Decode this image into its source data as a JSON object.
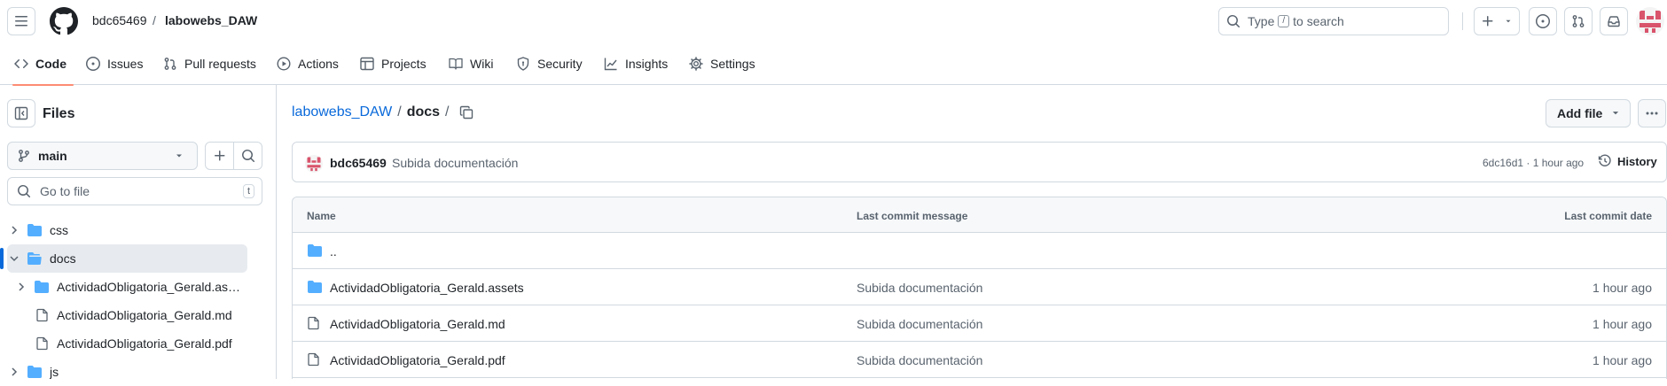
{
  "header": {
    "owner": "bdc65469",
    "separator": "/",
    "repo": "labowebs_DAW",
    "search_prefix": "Type",
    "search_key": "/",
    "search_suffix": "to search"
  },
  "repo_nav": [
    {
      "label": "Code",
      "icon": "code-icon",
      "active": true
    },
    {
      "label": "Issues",
      "icon": "issue-opened-icon"
    },
    {
      "label": "Pull requests",
      "icon": "git-pull-request-icon"
    },
    {
      "label": "Actions",
      "icon": "play-icon"
    },
    {
      "label": "Projects",
      "icon": "table-icon"
    },
    {
      "label": "Wiki",
      "icon": "book-icon"
    },
    {
      "label": "Security",
      "icon": "shield-icon"
    },
    {
      "label": "Insights",
      "icon": "graph-icon"
    },
    {
      "label": "Settings",
      "icon": "gear-icon"
    }
  ],
  "sidebar": {
    "title": "Files",
    "branch": "main",
    "goto_placeholder": "Go to file",
    "goto_key": "t",
    "tree": [
      {
        "label": "css",
        "type": "folder",
        "expanded": false
      },
      {
        "label": "docs",
        "type": "folder",
        "expanded": true,
        "selected": true
      },
      {
        "label": "ActividadObligatoria_Gerald.assets",
        "type": "folder",
        "expanded": false
      },
      {
        "label": "ActividadObligatoria_Gerald.md",
        "type": "file"
      },
      {
        "label": "ActividadObligatoria_Gerald.pdf",
        "type": "file"
      },
      {
        "label": "js",
        "type": "folder",
        "expanded": false
      }
    ]
  },
  "main": {
    "path_repo": "labowebs_DAW",
    "path_sep1": "/",
    "path_current": "docs",
    "path_sep2": "/",
    "add_file_label": "Add file",
    "commit": {
      "author": "bdc65469",
      "message": "Subida documentación",
      "hash_time": "6dc16d1 · 1 hour ago",
      "history_label": "History"
    },
    "table": {
      "headers": {
        "name": "Name",
        "message": "Last commit message",
        "date": "Last commit date"
      },
      "rows": [
        {
          "name": "..",
          "type": "parent",
          "message": "",
          "date": ""
        },
        {
          "name": "ActividadObligatoria_Gerald.assets",
          "type": "folder",
          "message": "Subida documentación",
          "date": "1 hour ago"
        },
        {
          "name": "ActividadObligatoria_Gerald.md",
          "type": "file",
          "message": "Subida documentación",
          "date": "1 hour ago"
        },
        {
          "name": "ActividadObligatoria_Gerald.pdf",
          "type": "file",
          "message": "Subida documentación",
          "date": "1 hour ago"
        }
      ]
    }
  },
  "colors": {
    "link": "#0969da",
    "folder": "#54aeff",
    "border": "#d1d9e0",
    "active_tab_underline": "#fd8c73",
    "selected_row": "#e7ebef",
    "muted_text": "#59636e"
  }
}
